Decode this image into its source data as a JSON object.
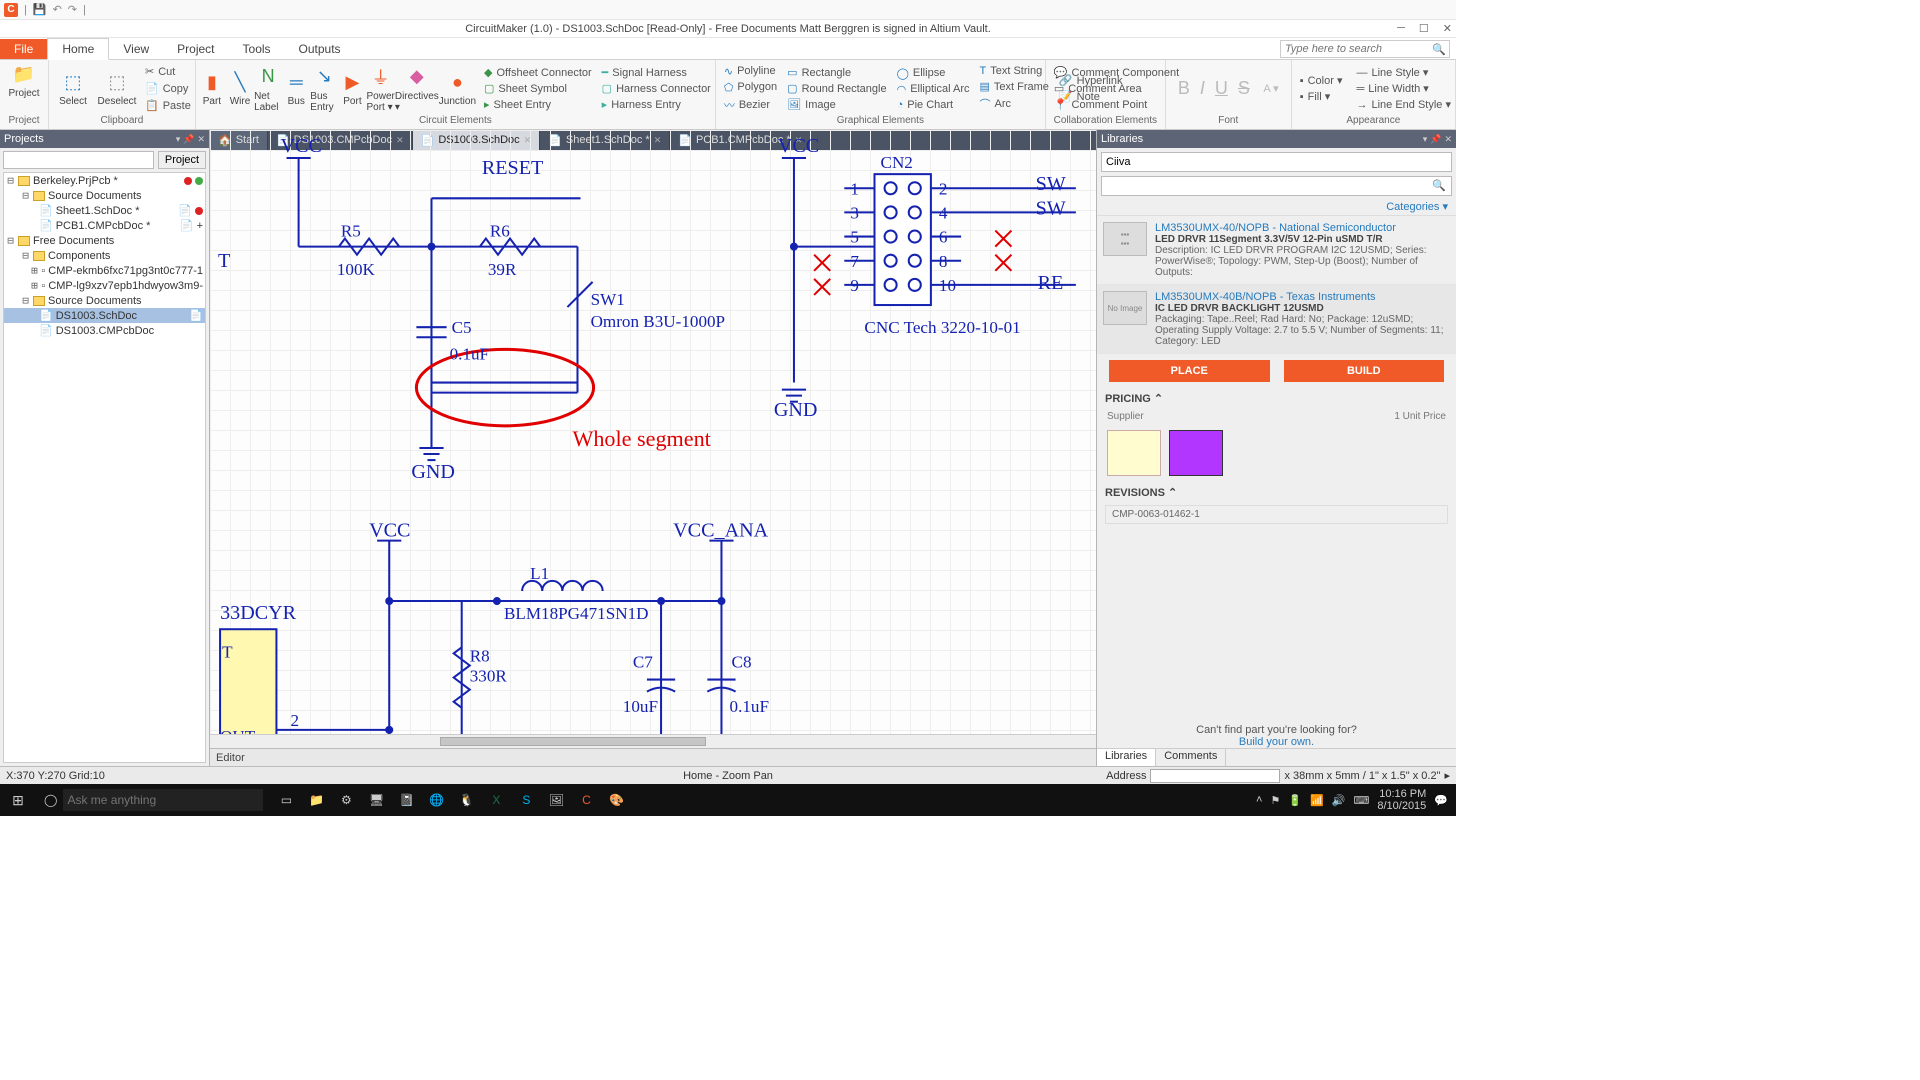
{
  "title": "CircuitMaker (1.0) - DS1003.SchDoc [Read-Only] - Free Documents Matt Berggren is signed in Altium Vault.",
  "ribbon_tabs": {
    "file": "File",
    "home": "Home",
    "view": "View",
    "project": "Project",
    "tools": "Tools",
    "outputs": "Outputs"
  },
  "searchph": "Type here to search",
  "ribbon": {
    "project": "Project",
    "project_btn": "Project",
    "clipboard": "Clipboard",
    "cut": "Cut",
    "copy": "Copy",
    "paste": "Paste",
    "select": "Select",
    "deselect": "Deselect",
    "circuit": "Circuit Elements",
    "part": "Part",
    "wire": "Wire",
    "netlabel": "Net Label",
    "bus": "Bus",
    "busentry": "Bus Entry",
    "port": "Port",
    "powerport": "Power Port ▾",
    "directives": "Directives ▾",
    "junction": "Junction",
    "offsheet": "Offsheet Connector",
    "sheetsym": "Sheet Symbol",
    "sheetentry": "Sheet Entry",
    "sigharness": "Signal Harness",
    "harnessconn": "Harness Connector",
    "harnessentry": "Harness Entry",
    "graphical": "Graphical Elements",
    "polyline": "Polyline",
    "polygon": "Polygon",
    "bezier": "Bezier",
    "rect": "Rectangle",
    "rrect": "Round Rectangle",
    "image": "Image",
    "ellipse": "Ellipse",
    "earc": "Elliptical Arc",
    "piechart": "Pie Chart",
    "textstr": "Text String",
    "textframe": "Text Frame",
    "arc": "Arc",
    "hyperlink": "Hyperlink",
    "note": "Note",
    "collab": "Collaboration Elements",
    "ccomp": "Comment Component",
    "carea": "Comment Area",
    "cpoint": "Comment Point",
    "font": "Font",
    "appearance": "Appearance",
    "color": "Color ▾",
    "fill": "Fill ▾",
    "linestyle": "Line Style ▾",
    "linewidth": "Line Width ▾",
    "lineend": "Line End Style ▾"
  },
  "doctabs": {
    "start": "Start",
    "t1": "DS1003.CMPcbDoc",
    "t2": "DS1003.SchDoc",
    "t3": "Sheet1.SchDoc *",
    "t4": "PCB1.CMPcbDoc *"
  },
  "left": {
    "hdr": "Projects",
    "projbtn": "Project",
    "n0": "Berkeley.PrjPcb *",
    "n1": "Source Documents",
    "n2": "Sheet1.SchDoc *",
    "n3": "PCB1.CMPcbDoc *",
    "n4": "Free Documents",
    "n5": "Components",
    "n6": "CMP-ekmb6fxc71pg3nt0c777-1",
    "n7": "CMP-lg9xzv7epb1hdwyow3m9-",
    "n8": "Source Documents",
    "n9": "DS1003.SchDoc",
    "n10": "DS1003.CMPcbDoc"
  },
  "canvas": {
    "editor": "Editor",
    "VCC1": "VCC",
    "VCC2": "VCC",
    "RESET": "RESET",
    "R5": "R5",
    "R5v": "100K",
    "R6": "R6",
    "R6v": "39R",
    "SW1": "SW1",
    "SW1p": "Omron B3U-1000P",
    "C5": "C5",
    "C5v": "0.1uF",
    "GND1": "GND",
    "GND2": "GND",
    "CN2": "CN2",
    "CN2p": "CNC Tech 3220-10-01",
    "p1": "1",
    "p2": "2",
    "p3": "3",
    "p4": "4",
    "p5": "5",
    "p6": "6",
    "p7": "7",
    "p8": "8",
    "p9": "9",
    "p10": "10",
    "SW_a": "SW",
    "SW_b": "SW",
    "RE": "RE",
    "T": "T",
    "VCC3": "VCC",
    "VCCANA": "VCC_ANA",
    "L1": "L1",
    "L1v": "BLM18PG471SN1D",
    "R8": "R8",
    "R8v": "330R",
    "C7": "C7",
    "C7v": "10uF",
    "C8": "C8",
    "C8v": "0.1uF",
    "reg": "33DCYR",
    "OUT": "OUT",
    "p2b": "2",
    "ann": "Whole segment"
  },
  "lib": {
    "hdr": "Libraries",
    "search": "Ciiva",
    "cat": "Categories ▾",
    "p1n": "LM3530UMX-40/NOPB - National Semiconductor",
    "p1d": "LED DRVR 11Segment 3.3V/5V 12-Pin uSMD T/R",
    "p1desc": "Description: IC LED DRVR PROGRAM I2C 12USMD; Series: PowerWise®; Topology: PWM, Step-Up (Boost); Number of Outputs:",
    "p2n": "LM3530UMX-40B/NOPB - Texas Instruments",
    "p2d": "IC LED DRVR BACKLIGHT 12USMD",
    "p2desc": "Packaging: Tape..Reel; Rad Hard: No; Package: 12uSMD; Operating Supply Voltage: 2.7 to 5.5 V; Number of Segments: 11; Category: LED",
    "place": "PLACE",
    "build": "BUILD",
    "pricing": "PRICING  ⌃",
    "supplier": "Supplier",
    "unitprice": "1  Unit Price",
    "rev": "REVISIONS  ⌃",
    "revid": "CMP-0063-01462-1",
    "noimg": "No Image",
    "find": "Can't find part you're looking for?",
    "buildown": "Build your own.",
    "tabL": "Libraries",
    "tabC": "Comments"
  },
  "status": {
    "coord": "X:370 Y:270  Grid:10",
    "mode": "Home - Zoom Pan",
    "addr": "Address",
    "dim": "x 38mm x 5mm / 1\" x 1.5\" x 0.2\""
  },
  "taskbar": {
    "cort": "Ask me anything",
    "time": "10:16 PM",
    "date": "8/10/2015"
  }
}
